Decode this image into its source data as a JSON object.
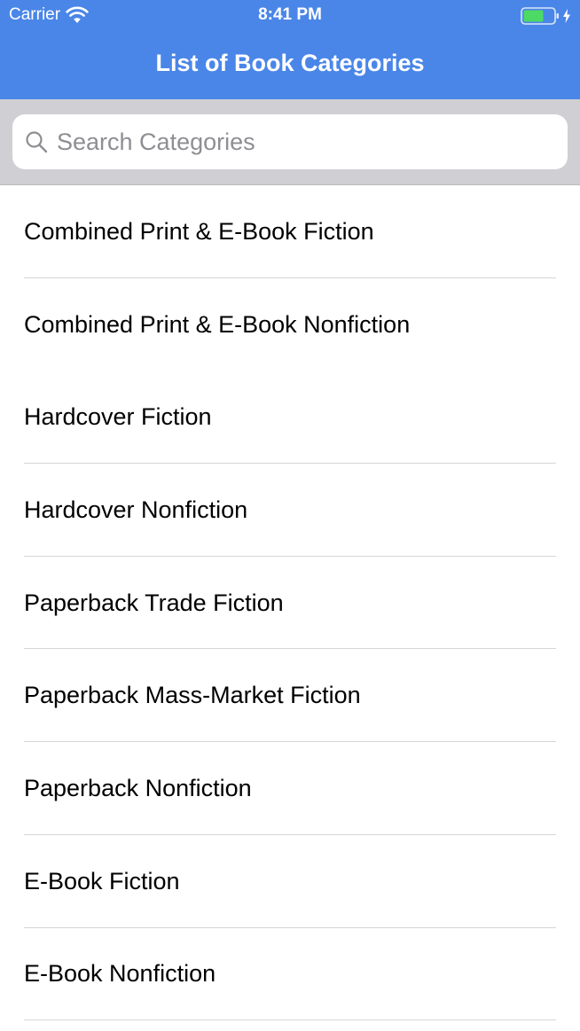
{
  "status_bar": {
    "carrier": "Carrier",
    "time": "8:41 PM",
    "icons": [
      "wifi-icon",
      "battery-icon",
      "charge-icon"
    ]
  },
  "navigation": {
    "title": "List of Book Categories"
  },
  "search": {
    "value": "",
    "placeholder": "Search Categories"
  },
  "categories": [
    {
      "label": "Combined Print & E-Book Fiction"
    },
    {
      "label": "Combined Print & E-Book Nonfiction"
    },
    {
      "label": "Hardcover Fiction"
    },
    {
      "label": "Hardcover Nonfiction"
    },
    {
      "label": "Paperback Trade Fiction"
    },
    {
      "label": "Paperback Mass-Market Fiction"
    },
    {
      "label": "Paperback Nonfiction"
    },
    {
      "label": "E-Book Fiction"
    },
    {
      "label": "E-Book Nonfiction"
    }
  ],
  "colors": {
    "header_background": "#4a86e8",
    "battery_fill": "#4cd964",
    "search_bar_background": "#cfcfd4",
    "placeholder_text": "#8e8e93",
    "separator": "#d6d6da"
  }
}
